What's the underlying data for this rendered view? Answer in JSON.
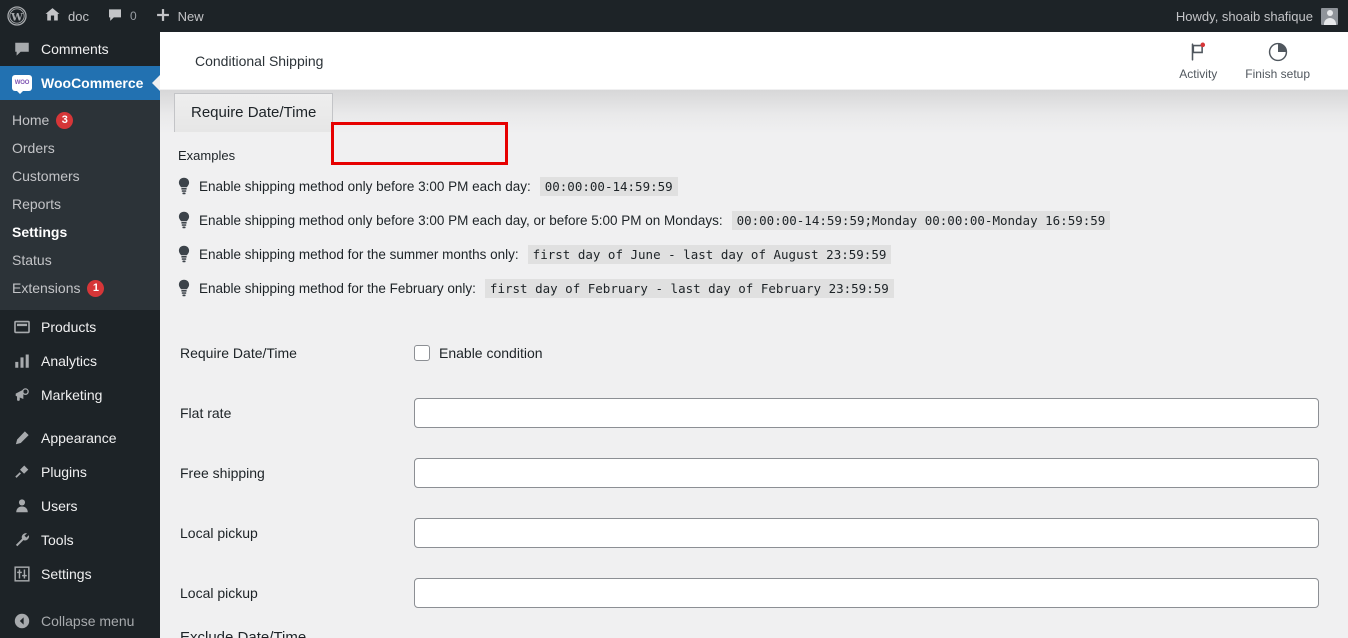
{
  "adminbar": {
    "wp_logo_icon": "wordpress-logo-icon",
    "site_name": "doc",
    "site_icon": "home-icon",
    "comments_icon": "comment-bubble-icon",
    "comments_count": "0",
    "new_icon": "plus-icon",
    "new_label": "New",
    "greeting": "Howdy, shoaib shafique",
    "avatar_icon": "user-avatar-icon"
  },
  "sidebar": {
    "items": [
      {
        "label": "Comments",
        "icon": "comment-bubble-icon",
        "current": false
      },
      {
        "label": "WooCommerce",
        "icon": "woocommerce-icon",
        "current": true
      },
      {
        "label": "Products",
        "icon": "products-icon",
        "current": false
      },
      {
        "label": "Analytics",
        "icon": "analytics-bar-chart-icon",
        "current": false
      },
      {
        "label": "Marketing",
        "icon": "megaphone-icon",
        "current": false
      },
      {
        "label": "Appearance",
        "icon": "paint-brush-icon",
        "current": false
      },
      {
        "label": "Plugins",
        "icon": "plug-icon",
        "current": false
      },
      {
        "label": "Users",
        "icon": "user-icon",
        "current": false
      },
      {
        "label": "Tools",
        "icon": "wrench-icon",
        "current": false
      },
      {
        "label": "Settings",
        "icon": "sliders-icon",
        "current": false
      }
    ],
    "woocommerce_submenu": [
      {
        "label": "Home",
        "badge": "3",
        "current": false
      },
      {
        "label": "Orders",
        "badge": "",
        "current": false
      },
      {
        "label": "Customers",
        "badge": "",
        "current": false
      },
      {
        "label": "Reports",
        "badge": "",
        "current": false
      },
      {
        "label": "Settings",
        "badge": "",
        "current": true
      },
      {
        "label": "Status",
        "badge": "",
        "current": false
      },
      {
        "label": "Extensions",
        "badge": "1",
        "current": false
      }
    ],
    "collapse": {
      "label": "Collapse menu",
      "icon": "collapse-arrow-icon"
    },
    "accent_color": "#2271b1",
    "badge_color": "#d63638"
  },
  "header": {
    "title": "Conditional Shipping",
    "actions": [
      {
        "label": "Activity",
        "icon": "activity-flag-icon"
      },
      {
        "label": "Finish setup",
        "icon": "progress-circle-icon"
      }
    ]
  },
  "tabs": {
    "active_tab": "Require Date/Time",
    "highlight_color": "#e60000"
  },
  "examples": {
    "heading": "Examples",
    "items": [
      {
        "icon": "lightbulb-icon",
        "text": "Enable shipping method only before 3:00 PM each day:",
        "code": "00:00:00-14:59:59"
      },
      {
        "icon": "lightbulb-icon",
        "text": "Enable shipping method only before 3:00 PM each day, or before 5:00 PM on Mondays:",
        "code": "00:00:00-14:59:59;Monday 00:00:00-Monday 16:59:59"
      },
      {
        "icon": "lightbulb-icon",
        "text": "Enable shipping method for the summer months only:",
        "code": "first day of June - last day of August 23:59:59"
      },
      {
        "icon": "lightbulb-icon",
        "text": "Enable shipping method for the February only:",
        "code": "first day of February - last day of February 23:59:59"
      }
    ]
  },
  "form": {
    "enable_row": {
      "label": "Require Date/Time",
      "checkbox_label": "Enable condition",
      "checked": false
    },
    "rows": [
      {
        "label": "Flat rate",
        "value": "",
        "placeholder": ""
      },
      {
        "label": "Free shipping",
        "value": "",
        "placeholder": ""
      },
      {
        "label": "Local pickup",
        "value": "",
        "placeholder": ""
      },
      {
        "label": "Local pickup",
        "value": "",
        "placeholder": ""
      }
    ],
    "next_section": "Exclude Date/Time"
  }
}
